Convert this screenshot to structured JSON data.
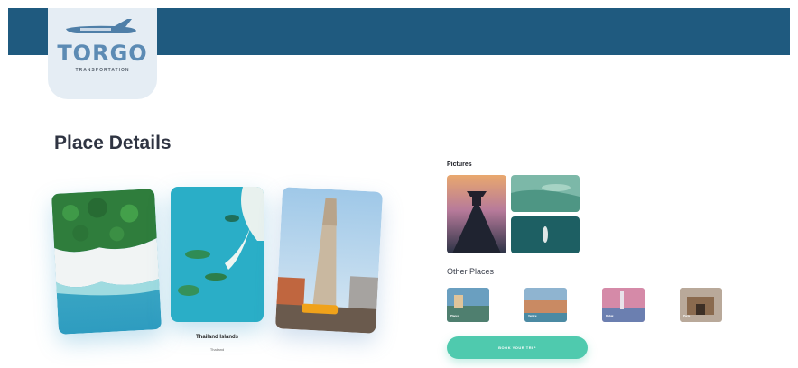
{
  "brand": {
    "name": "TORGO",
    "tagline": "TRANSPORTATION",
    "plane_icon": "airplane-icon",
    "color_header": "#1f5a7f",
    "color_logo_bg": "#e5edf4",
    "color_logo_text": "#5c8bb4"
  },
  "page": {
    "title": "Place Details"
  },
  "gallery": {
    "cards": [
      {
        "subject": "aerial coastline"
      },
      {
        "subject": "turquoise islands"
      },
      {
        "subject": "city tower"
      }
    ],
    "featured_caption": "Thailand Islands",
    "featured_sub": "Thailand"
  },
  "pictures": {
    "label": "Pictures"
  },
  "other_places": {
    "label": "Other Places",
    "items": [
      {
        "name": "Places"
      },
      {
        "name": "Venice"
      },
      {
        "name": "Dubai"
      },
      {
        "name": "Paris"
      }
    ]
  },
  "actions": {
    "book_label": "BOOK YOUR TRIP",
    "accent_color": "#4fcaae"
  }
}
